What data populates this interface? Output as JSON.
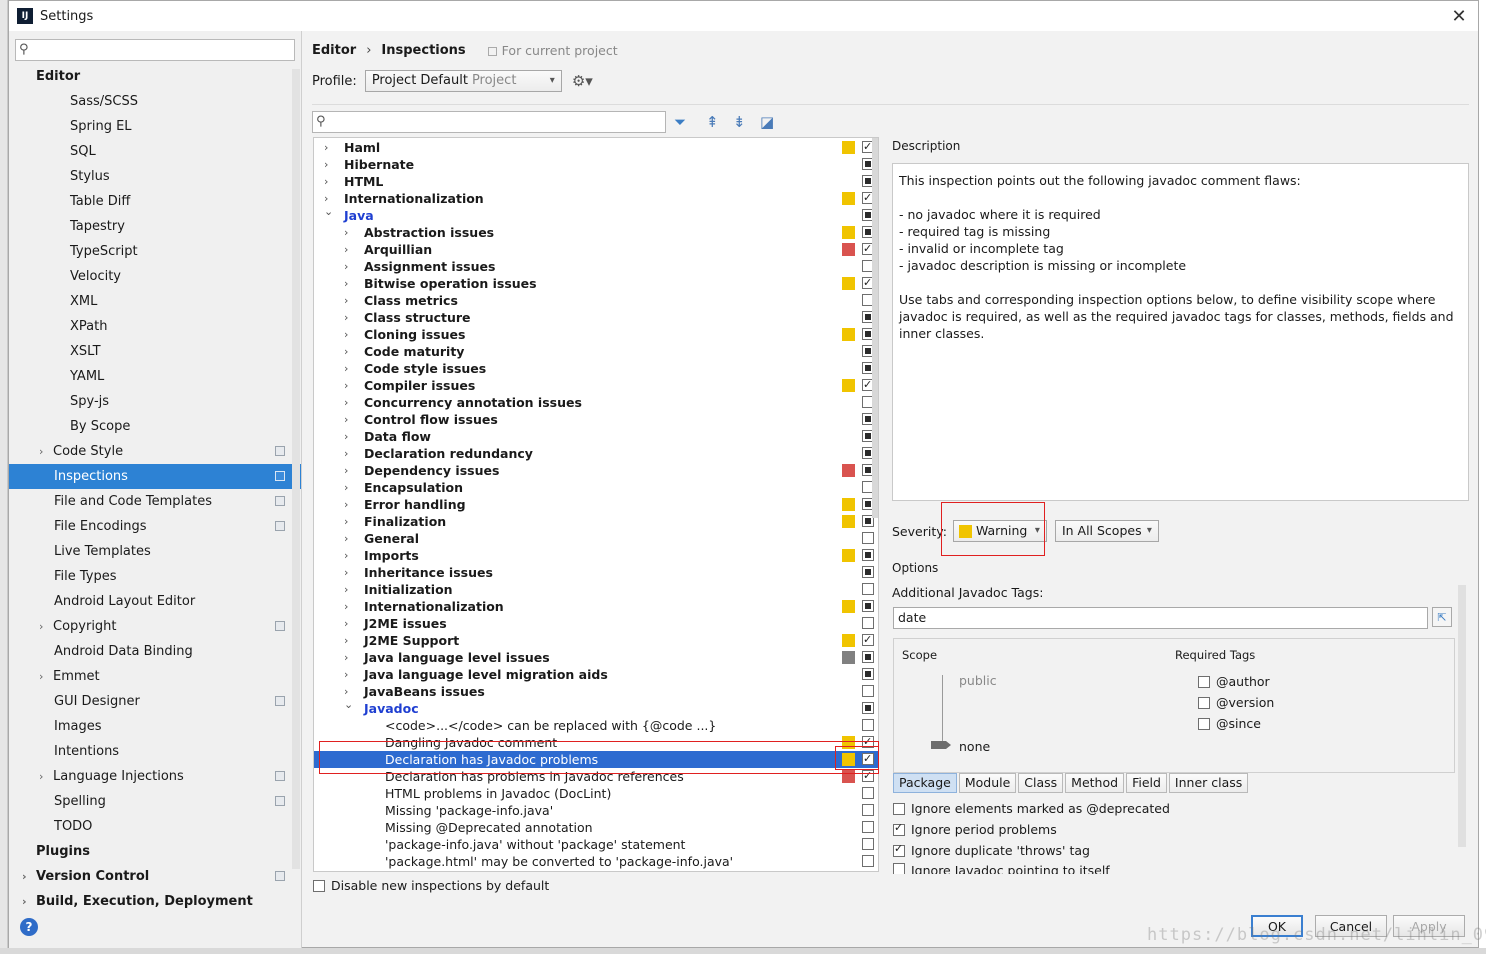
{
  "window": {
    "title": "Settings"
  },
  "sidebar": {
    "search_placeholder": "",
    "items": [
      {
        "label": "Editor",
        "level": 0,
        "section": true
      },
      {
        "label": "Sass/SCSS",
        "level": 3
      },
      {
        "label": "Spring EL",
        "level": 3
      },
      {
        "label": "SQL",
        "level": 3
      },
      {
        "label": "Stylus",
        "level": 3
      },
      {
        "label": "Table Diff",
        "level": 3
      },
      {
        "label": "Tapestry",
        "level": 3
      },
      {
        "label": "TypeScript",
        "level": 3
      },
      {
        "label": "Velocity",
        "level": 3
      },
      {
        "label": "XML",
        "level": 3
      },
      {
        "label": "XPath",
        "level": 3
      },
      {
        "label": "XSLT",
        "level": 3
      },
      {
        "label": "YAML",
        "level": 3
      },
      {
        "label": "Spy-js",
        "level": 3
      },
      {
        "label": "By Scope",
        "level": 3
      },
      {
        "label": "Code Style",
        "level": 1,
        "chevron": true,
        "proj": true
      },
      {
        "label": "Inspections",
        "level": 2,
        "selected": true,
        "proj": true
      },
      {
        "label": "File and Code Templates",
        "level": 2,
        "proj": true
      },
      {
        "label": "File Encodings",
        "level": 2,
        "proj": true
      },
      {
        "label": "Live Templates",
        "level": 2
      },
      {
        "label": "File Types",
        "level": 2
      },
      {
        "label": "Android Layout Editor",
        "level": 2
      },
      {
        "label": "Copyright",
        "level": 1,
        "chevron": true,
        "proj": true
      },
      {
        "label": "Android Data Binding",
        "level": 2
      },
      {
        "label": "Emmet",
        "level": 1,
        "chevron": true
      },
      {
        "label": "GUI Designer",
        "level": 2,
        "proj": true
      },
      {
        "label": "Images",
        "level": 2
      },
      {
        "label": "Intentions",
        "level": 2
      },
      {
        "label": "Language Injections",
        "level": 1,
        "chevron": true,
        "proj": true
      },
      {
        "label": "Spelling",
        "level": 2,
        "proj": true
      },
      {
        "label": "TODO",
        "level": 2
      },
      {
        "label": "Plugins",
        "level": 0,
        "section": true
      },
      {
        "label": "Version Control",
        "level": 0,
        "section": true,
        "chevron": true,
        "proj": true
      },
      {
        "label": "Build, Execution, Deployment",
        "level": 0,
        "section": true,
        "chevron": true
      }
    ]
  },
  "breadcrumb": {
    "part1": "Editor",
    "sep": "›",
    "part2": "Inspections",
    "scope": "For current project"
  },
  "profile": {
    "label": "Profile:",
    "value": "Project Default",
    "sub": "Project"
  },
  "inspection_search_placeholder": "",
  "tree": [
    {
      "label": "Haml",
      "level": 0,
      "chev": ">",
      "bold": true,
      "sev": "warning",
      "cb": "checked"
    },
    {
      "label": "Hibernate",
      "level": 0,
      "chev": ">",
      "bold": true,
      "sev": "",
      "cb": "mixed"
    },
    {
      "label": "HTML",
      "level": 0,
      "chev": ">",
      "bold": true,
      "sev": "",
      "cb": "mixed"
    },
    {
      "label": "Internationalization",
      "level": 0,
      "chev": ">",
      "bold": true,
      "sev": "warning",
      "cb": "checked"
    },
    {
      "label": "Java",
      "level": 0,
      "chev": "v",
      "bold": true,
      "blue": true,
      "sev": "",
      "cb": "mixed"
    },
    {
      "label": "Abstraction issues",
      "level": 1,
      "chev": ">",
      "bold": true,
      "sev": "warning",
      "cb": "mixed"
    },
    {
      "label": "Arquillian",
      "level": 1,
      "chev": ">",
      "bold": true,
      "sev": "error",
      "cb": "checked"
    },
    {
      "label": "Assignment issues",
      "level": 1,
      "chev": ">",
      "bold": true,
      "sev": "",
      "cb": "unchecked"
    },
    {
      "label": "Bitwise operation issues",
      "level": 1,
      "chev": ">",
      "bold": true,
      "sev": "warning",
      "cb": "checked"
    },
    {
      "label": "Class metrics",
      "level": 1,
      "chev": ">",
      "bold": true,
      "sev": "",
      "cb": "unchecked"
    },
    {
      "label": "Class structure",
      "level": 1,
      "chev": ">",
      "bold": true,
      "sev": "",
      "cb": "mixed"
    },
    {
      "label": "Cloning issues",
      "level": 1,
      "chev": ">",
      "bold": true,
      "sev": "warning",
      "cb": "mixed"
    },
    {
      "label": "Code maturity",
      "level": 1,
      "chev": ">",
      "bold": true,
      "sev": "",
      "cb": "mixed"
    },
    {
      "label": "Code style issues",
      "level": 1,
      "chev": ">",
      "bold": true,
      "sev": "",
      "cb": "mixed"
    },
    {
      "label": "Compiler issues",
      "level": 1,
      "chev": ">",
      "bold": true,
      "sev": "warning",
      "cb": "checked"
    },
    {
      "label": "Concurrency annotation issues",
      "level": 1,
      "chev": ">",
      "bold": true,
      "sev": "",
      "cb": "unchecked"
    },
    {
      "label": "Control flow issues",
      "level": 1,
      "chev": ">",
      "bold": true,
      "sev": "",
      "cb": "mixed"
    },
    {
      "label": "Data flow",
      "level": 1,
      "chev": ">",
      "bold": true,
      "sev": "",
      "cb": "mixed"
    },
    {
      "label": "Declaration redundancy",
      "level": 1,
      "chev": ">",
      "bold": true,
      "sev": "",
      "cb": "mixed"
    },
    {
      "label": "Dependency issues",
      "level": 1,
      "chev": ">",
      "bold": true,
      "sev": "error",
      "cb": "mixed"
    },
    {
      "label": "Encapsulation",
      "level": 1,
      "chev": ">",
      "bold": true,
      "sev": "",
      "cb": "unchecked"
    },
    {
      "label": "Error handling",
      "level": 1,
      "chev": ">",
      "bold": true,
      "sev": "warning",
      "cb": "mixed"
    },
    {
      "label": "Finalization",
      "level": 1,
      "chev": ">",
      "bold": true,
      "sev": "warning",
      "cb": "mixed"
    },
    {
      "label": "General",
      "level": 1,
      "chev": ">",
      "bold": true,
      "sev": "",
      "cb": "unchecked"
    },
    {
      "label": "Imports",
      "level": 1,
      "chev": ">",
      "bold": true,
      "sev": "warning",
      "cb": "mixed"
    },
    {
      "label": "Inheritance issues",
      "level": 1,
      "chev": ">",
      "bold": true,
      "sev": "",
      "cb": "mixed"
    },
    {
      "label": "Initialization",
      "level": 1,
      "chev": ">",
      "bold": true,
      "sev": "",
      "cb": "unchecked"
    },
    {
      "label": "Internationalization",
      "level": 1,
      "chev": ">",
      "bold": true,
      "sev": "warning",
      "cb": "mixed"
    },
    {
      "label": "J2ME issues",
      "level": 1,
      "chev": ">",
      "bold": true,
      "sev": "",
      "cb": "unchecked"
    },
    {
      "label": "J2ME Support",
      "level": 1,
      "chev": ">",
      "bold": true,
      "sev": "warning",
      "cb": "checked"
    },
    {
      "label": "Java language level issues",
      "level": 1,
      "chev": ">",
      "bold": true,
      "sev": "weak",
      "cb": "mixed"
    },
    {
      "label": "Java language level migration aids",
      "level": 1,
      "chev": ">",
      "bold": true,
      "sev": "",
      "cb": "mixed"
    },
    {
      "label": "JavaBeans issues",
      "level": 1,
      "chev": ">",
      "bold": true,
      "sev": "",
      "cb": "unchecked"
    },
    {
      "label": "Javadoc",
      "level": 1,
      "chev": "v",
      "bold": true,
      "blue": true,
      "sev": "",
      "cb": "mixed"
    },
    {
      "label": "<code>...</code> can be replaced with {@code ...}",
      "level": 2,
      "chev": "",
      "sev": "",
      "cb": "unchecked"
    },
    {
      "label": "Dangling Javadoc comment",
      "level": 2,
      "chev": "",
      "sev": "warning",
      "cb": "checked"
    },
    {
      "label": "Declaration has Javadoc problems",
      "level": 2,
      "chev": "",
      "sev": "warning",
      "cb": "checked",
      "selected": true
    },
    {
      "label": "Declaration has problems in Javadoc references",
      "level": 2,
      "chev": "",
      "sev": "error",
      "cb": "checked"
    },
    {
      "label": "HTML problems in Javadoc (DocLint)",
      "level": 2,
      "chev": "",
      "sev": "",
      "cb": "unchecked"
    },
    {
      "label": "Missing 'package-info.java'",
      "level": 2,
      "chev": "",
      "sev": "",
      "cb": "unchecked"
    },
    {
      "label": "Missing @Deprecated annotation",
      "level": 2,
      "chev": "",
      "sev": "",
      "cb": "unchecked"
    },
    {
      "label": "'package-info.java' without 'package' statement",
      "level": 2,
      "chev": "",
      "sev": "",
      "cb": "unchecked"
    },
    {
      "label": "'package.html' may be converted to 'package-info.java'",
      "level": 2,
      "chev": "",
      "sev": "",
      "cb": "unchecked"
    }
  ],
  "disable_new_label": "Disable new inspections by default",
  "description": {
    "label": "Description",
    "intro": "This inspection points out the following javadoc comment flaws:",
    "bullets": [
      "- no javadoc where it is required",
      "- required tag is missing",
      "- invalid or incomplete tag",
      "- javadoc description is missing or incomplete"
    ],
    "outro": "Use tabs and corresponding inspection options below, to define visibility scope where javadoc is required, as well as the required javadoc tags for classes, methods, fields and inner classes."
  },
  "severity": {
    "label": "Severity:",
    "value": "Warning",
    "scope": "In All Scopes"
  },
  "options": {
    "label": "Options",
    "additional_tags_label": "Additional Javadoc Tags:",
    "additional_tags_value": "date",
    "scope_header": "Scope",
    "required_header": "Required Tags",
    "scope_public": "public",
    "scope_none": "none",
    "required_tags": [
      {
        "label": "@author",
        "checked": false
      },
      {
        "label": "@version",
        "checked": false
      },
      {
        "label": "@since",
        "checked": false
      }
    ],
    "tabs": [
      "Package",
      "Module",
      "Class",
      "Method",
      "Field",
      "Inner class"
    ],
    "checks": [
      {
        "label": "Ignore elements marked as @deprecated",
        "checked": false
      },
      {
        "label": "Ignore period problems",
        "checked": true
      },
      {
        "label": "Ignore duplicate 'throws' tag",
        "checked": true
      },
      {
        "label": "Ignore Javadoc pointing to itself",
        "checked": false
      }
    ]
  },
  "buttons": {
    "ok": "OK",
    "cancel": "Cancel",
    "apply": "Apply"
  },
  "watermark": "https://blog.csdn.net/linlin_0904",
  "colors": {
    "warning": "#f0c400",
    "error": "#d9534f",
    "weak": "#808080",
    "selection": "#2d6bd0",
    "sidebar_selection": "#2d82d4"
  }
}
